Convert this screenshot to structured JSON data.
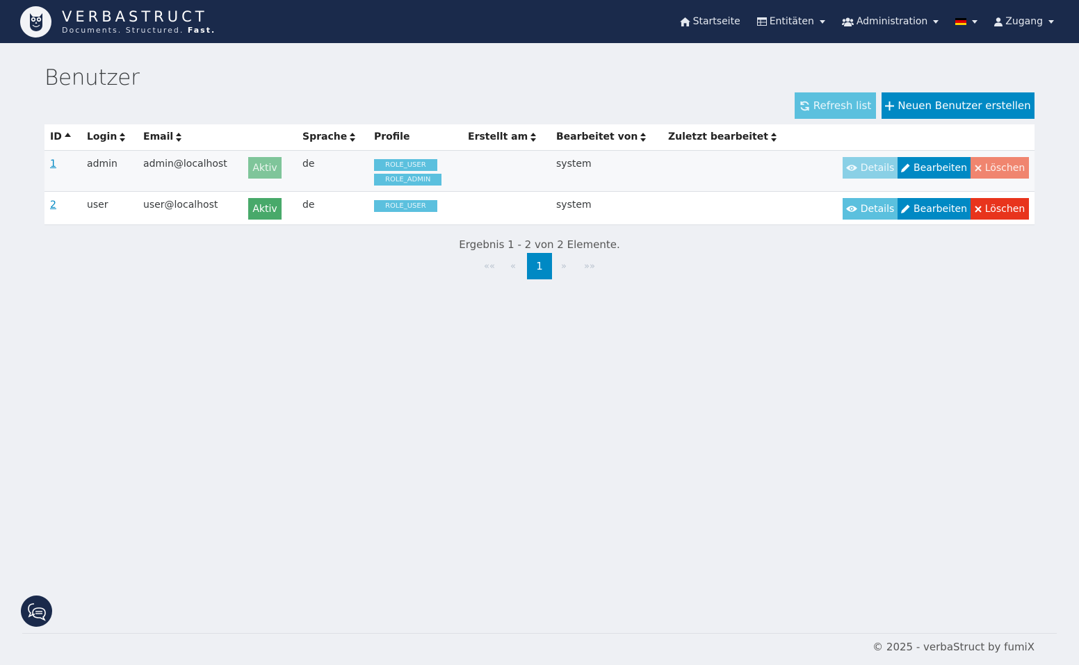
{
  "brand": {
    "name": "VERBASTRUCT",
    "tagline_start": "Documents. Structured.",
    "tagline_bold": "Fast."
  },
  "nav": {
    "home": "Startseite",
    "entities": "Entitäten",
    "administration": "Administration",
    "language_icon": "flag-de-icon",
    "account": "Zugang"
  },
  "page": {
    "title": "Benutzer",
    "refresh_label": "Refresh list",
    "create_label": "Neuen Benutzer erstellen"
  },
  "table": {
    "headers": {
      "id": "ID",
      "login": "Login",
      "email": "Email",
      "language": "Sprache",
      "profiles": "Profile",
      "created": "Erstellt am",
      "modified_by": "Bearbeitet von",
      "last_modified": "Zuletzt bearbeitet"
    },
    "rows": [
      {
        "id": "1",
        "login": "admin",
        "email": "admin@localhost",
        "status": "Aktiv",
        "language": "de",
        "roles": [
          "ROLE_USER",
          "ROLE_ADMIN"
        ],
        "created": "",
        "modified_by": "system",
        "last_modified": ""
      },
      {
        "id": "2",
        "login": "user",
        "email": "user@localhost",
        "status": "Aktiv",
        "language": "de",
        "roles": [
          "ROLE_USER"
        ],
        "created": "",
        "modified_by": "system",
        "last_modified": ""
      }
    ],
    "actions": {
      "details": "Details",
      "edit": "Bearbeiten",
      "delete": "Löschen"
    }
  },
  "pagination": {
    "info": "Ergebnis 1 - 2 von 2 Elemente.",
    "first": "««",
    "prev": "«",
    "current": "1",
    "next": "»",
    "last": "»»"
  },
  "footer": {
    "text": "© 2025 - verbaStruct by fumiX"
  },
  "colors": {
    "navbar": "#1a2a4b",
    "primary": "#0089c4",
    "info": "#5bc0de",
    "success": "#48a96a",
    "danger": "#e8341c",
    "background": "#eef0f4"
  }
}
